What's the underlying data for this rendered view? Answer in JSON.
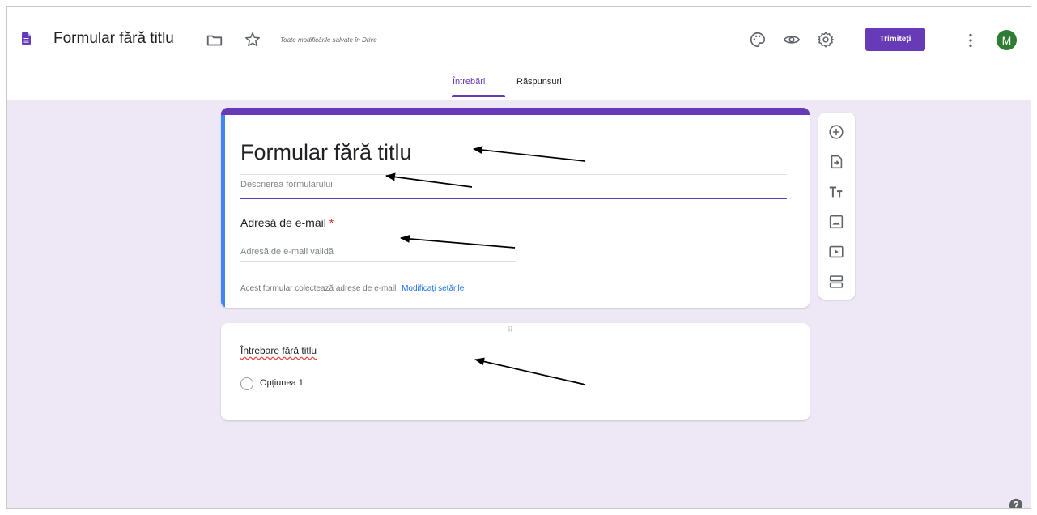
{
  "header": {
    "form_title": "Formular fără titlu",
    "save_status": "Toate modificările salvate în Drive",
    "send_label": "Trimiteți",
    "avatar_initial": "M"
  },
  "tabs": [
    {
      "label": "Întrebări",
      "active": true
    },
    {
      "label": "Răspunsuri",
      "active": false
    }
  ],
  "form": {
    "title": "Formular fără titlu",
    "description_placeholder": "Descrierea formularului",
    "email_label": "Adresă de e-mail",
    "email_required_mark": "*",
    "email_placeholder": "Adresă de e-mail validă",
    "collect_note": "Acest formular colectează adrese de e-mail.",
    "change_settings_link": "Modificați setările"
  },
  "question": {
    "title": "Întrebare fără titlu",
    "option_1": "Opțiunea 1"
  },
  "toolbar_icons": [
    "add-question-icon",
    "import-questions-icon",
    "add-title-icon",
    "add-image-icon",
    "add-video-icon",
    "add-section-icon"
  ],
  "colors": {
    "accent": "#673ab7",
    "background": "#ede7f6",
    "focus_bar": "#4285f4",
    "avatar": "#2e7d32"
  }
}
